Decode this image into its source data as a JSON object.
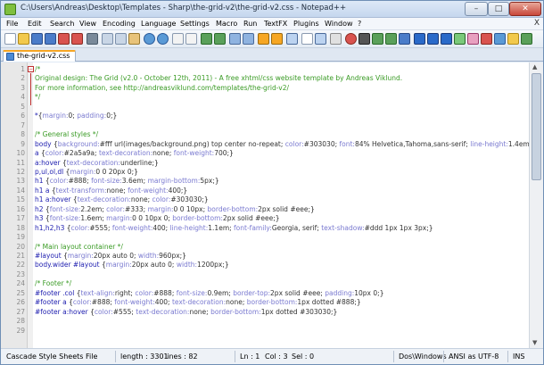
{
  "window": {
    "title": "C:\\Users\\Andreas\\Desktop\\Templates - Sharp\\the-grid-v2\\the-grid-v2.css - Notepad++",
    "min_label": "–",
    "max_label": "□",
    "close_label": "✕"
  },
  "menu": {
    "items": [
      "File",
      "Edit",
      "Search",
      "View",
      "Encoding",
      "Language",
      "Settings",
      "Macro",
      "Run",
      "TextFX",
      "Plugins",
      "Window",
      "?"
    ],
    "close_x": "X"
  },
  "tab": {
    "label": "the-grid-v2.css"
  },
  "lines": [
    {
      "n": "1",
      "parts": [
        [
          "c-comment",
          "/*"
        ]
      ]
    },
    {
      "n": "2",
      "parts": [
        [
          "c-comment",
          "Original design: The Grid (v2.0 - October 12th, 2011) - A free xhtml/css website template by Andreas Viklund."
        ]
      ]
    },
    {
      "n": "3",
      "parts": [
        [
          "c-comment",
          "For more information, see http://andreasviklund.com/templates/the-grid-v2/"
        ]
      ]
    },
    {
      "n": "4",
      "parts": [
        [
          "c-comment",
          "*/"
        ]
      ]
    },
    {
      "n": "5",
      "parts": []
    },
    {
      "n": "6",
      "parts": [
        [
          "c-sel",
          "*"
        ],
        [
          "c-br",
          "{"
        ],
        [
          "c-prop",
          "margin:"
        ],
        [
          "c-val",
          "0; "
        ],
        [
          "c-prop",
          "padding:"
        ],
        [
          "c-val",
          "0;"
        ],
        [
          "c-br",
          "}"
        ]
      ]
    },
    {
      "n": "7",
      "parts": []
    },
    {
      "n": "8",
      "parts": [
        [
          "c-comment",
          "/* General styles */"
        ]
      ]
    },
    {
      "n": "9",
      "parts": [
        [
          "c-sel",
          "body "
        ],
        [
          "c-br",
          "{"
        ],
        [
          "c-prop",
          "background:"
        ],
        [
          "c-val",
          "#fff url(images/background.png) top center no-repeat; "
        ],
        [
          "c-prop",
          "color:"
        ],
        [
          "c-val",
          "#303030; "
        ],
        [
          "c-prop",
          "font:"
        ],
        [
          "c-val",
          "84% Helvetica,Tahoma,sans-serif; "
        ],
        [
          "c-prop",
          "line-height:"
        ],
        [
          "c-val",
          "1.4em;"
        ],
        [
          "c-br",
          "}"
        ]
      ]
    },
    {
      "n": "10",
      "parts": [
        [
          "c-sel",
          "a "
        ],
        [
          "c-br",
          "{"
        ],
        [
          "c-prop",
          "color:"
        ],
        [
          "c-val",
          "#2a5a9a; "
        ],
        [
          "c-prop",
          "text-decoration:"
        ],
        [
          "c-val",
          "none; "
        ],
        [
          "c-prop",
          "font-weight:"
        ],
        [
          "c-val",
          "700;"
        ],
        [
          "c-br",
          "}"
        ]
      ]
    },
    {
      "n": "11",
      "parts": [
        [
          "c-sel",
          "a:hover "
        ],
        [
          "c-br",
          "{"
        ],
        [
          "c-prop",
          "text-decoration:"
        ],
        [
          "c-val",
          "underline;"
        ],
        [
          "c-br",
          "}"
        ]
      ]
    },
    {
      "n": "12",
      "parts": [
        [
          "c-sel",
          "p,ul,ol,dl "
        ],
        [
          "c-br",
          "{"
        ],
        [
          "c-prop",
          "margin:"
        ],
        [
          "c-val",
          "0 0 20px 0;"
        ],
        [
          "c-br",
          "}"
        ]
      ]
    },
    {
      "n": "13",
      "parts": [
        [
          "c-sel",
          "h1 "
        ],
        [
          "c-br",
          "{"
        ],
        [
          "c-prop",
          "color:"
        ],
        [
          "c-val",
          "#888; "
        ],
        [
          "c-prop",
          "font-size:"
        ],
        [
          "c-val",
          "3.6em; "
        ],
        [
          "c-prop",
          "margin-bottom:"
        ],
        [
          "c-val",
          "5px;"
        ],
        [
          "c-br",
          "}"
        ]
      ]
    },
    {
      "n": "14",
      "parts": [
        [
          "c-sel",
          "h1 a "
        ],
        [
          "c-br",
          "{"
        ],
        [
          "c-prop",
          "text-transform:"
        ],
        [
          "c-val",
          "none; "
        ],
        [
          "c-prop",
          "font-weight:"
        ],
        [
          "c-val",
          "400;"
        ],
        [
          "c-br",
          "}"
        ]
      ]
    },
    {
      "n": "15",
      "parts": [
        [
          "c-sel",
          "h1 a:hover "
        ],
        [
          "c-br",
          "{"
        ],
        [
          "c-prop",
          "text-decoration:"
        ],
        [
          "c-val",
          "none; "
        ],
        [
          "c-prop",
          "color:"
        ],
        [
          "c-val",
          "#303030;"
        ],
        [
          "c-br",
          "}"
        ]
      ]
    },
    {
      "n": "16",
      "parts": [
        [
          "c-sel",
          "h2 "
        ],
        [
          "c-br",
          "{"
        ],
        [
          "c-prop",
          "font-size:"
        ],
        [
          "c-val",
          "2.2em; "
        ],
        [
          "c-prop",
          "color:"
        ],
        [
          "c-val",
          "#333; "
        ],
        [
          "c-prop",
          "margin:"
        ],
        [
          "c-val",
          "0 0 10px; "
        ],
        [
          "c-prop",
          "border-bottom:"
        ],
        [
          "c-val",
          "2px solid #eee;"
        ],
        [
          "c-br",
          "}"
        ]
      ]
    },
    {
      "n": "17",
      "parts": [
        [
          "c-sel",
          "h3 "
        ],
        [
          "c-br",
          "{"
        ],
        [
          "c-prop",
          "font-size:"
        ],
        [
          "c-val",
          "1.6em; "
        ],
        [
          "c-prop",
          "margin:"
        ],
        [
          "c-val",
          "0 0 10px 0; "
        ],
        [
          "c-prop",
          "border-bottom:"
        ],
        [
          "c-val",
          "2px solid #eee;"
        ],
        [
          "c-br",
          "}"
        ]
      ]
    },
    {
      "n": "18",
      "parts": [
        [
          "c-sel",
          "h1,h2,h3 "
        ],
        [
          "c-br",
          "{"
        ],
        [
          "c-prop",
          "color:"
        ],
        [
          "c-val",
          "#555; "
        ],
        [
          "c-prop",
          "font-weight:"
        ],
        [
          "c-val",
          "400; "
        ],
        [
          "c-prop",
          "line-height:"
        ],
        [
          "c-val",
          "1.1em; "
        ],
        [
          "c-prop",
          "font-family:"
        ],
        [
          "c-val",
          "Georgia, serif; "
        ],
        [
          "c-prop",
          "text-shadow:"
        ],
        [
          "c-val",
          "#ddd 1px 1px 3px;"
        ],
        [
          "c-br",
          "}"
        ]
      ]
    },
    {
      "n": "19",
      "parts": []
    },
    {
      "n": "20",
      "parts": [
        [
          "c-comment",
          "/* Main layout container */"
        ]
      ]
    },
    {
      "n": "21",
      "parts": [
        [
          "c-sel",
          "#layout "
        ],
        [
          "c-br",
          "{"
        ],
        [
          "c-prop",
          "margin:"
        ],
        [
          "c-val",
          "20px auto 0; "
        ],
        [
          "c-prop",
          "width:"
        ],
        [
          "c-val",
          "960px;"
        ],
        [
          "c-br",
          "}"
        ]
      ]
    },
    {
      "n": "22",
      "parts": [
        [
          "c-sel",
          "body.wider #layout "
        ],
        [
          "c-br",
          "{"
        ],
        [
          "c-prop",
          "margin:"
        ],
        [
          "c-val",
          "20px auto 0; "
        ],
        [
          "c-prop",
          "width:"
        ],
        [
          "c-val",
          "1200px;"
        ],
        [
          "c-br",
          "}"
        ]
      ]
    },
    {
      "n": "23",
      "parts": []
    },
    {
      "n": "24",
      "parts": [
        [
          "c-comment",
          "/* Footer */"
        ]
      ]
    },
    {
      "n": "25",
      "parts": [
        [
          "c-sel",
          "#footer .col "
        ],
        [
          "c-br",
          "{"
        ],
        [
          "c-prop",
          "text-align:"
        ],
        [
          "c-val",
          "right; "
        ],
        [
          "c-prop",
          "color:"
        ],
        [
          "c-val",
          "#888; "
        ],
        [
          "c-prop",
          "font-size:"
        ],
        [
          "c-val",
          "0.9em; "
        ],
        [
          "c-prop",
          "border-top:"
        ],
        [
          "c-val",
          "2px solid #eee; "
        ],
        [
          "c-prop",
          "padding:"
        ],
        [
          "c-val",
          "10px 0;"
        ],
        [
          "c-br",
          "}"
        ]
      ]
    },
    {
      "n": "26",
      "parts": [
        [
          "c-sel",
          "#footer a "
        ],
        [
          "c-br",
          "{"
        ],
        [
          "c-prop",
          "color:"
        ],
        [
          "c-val",
          "#888; "
        ],
        [
          "c-prop",
          "font-weight:"
        ],
        [
          "c-val",
          "400; "
        ],
        [
          "c-prop",
          "text-decoration:"
        ],
        [
          "c-val",
          "none; "
        ],
        [
          "c-prop",
          "border-bottom:"
        ],
        [
          "c-val",
          "1px dotted #888;"
        ],
        [
          "c-br",
          "}"
        ]
      ]
    },
    {
      "n": "27",
      "parts": [
        [
          "c-sel",
          "#footer a:hover "
        ],
        [
          "c-br",
          "{"
        ],
        [
          "c-prop",
          "color:"
        ],
        [
          "c-val",
          "#555; "
        ],
        [
          "c-prop",
          "text-decoration:"
        ],
        [
          "c-val",
          "none; "
        ],
        [
          "c-prop",
          "border-bottom:"
        ],
        [
          "c-val",
          "1px dotted #303030;"
        ],
        [
          "c-br",
          "}"
        ]
      ]
    },
    {
      "n": "28",
      "parts": []
    },
    {
      "n": "29",
      "parts": []
    }
  ],
  "status": {
    "file_type": "Cascade Style Sheets File",
    "length": "length : 3301",
    "lines": "lines : 82",
    "ln": "Ln : 1",
    "col": "Col : 3",
    "sel": "Sel : 0",
    "eol": "Dos\\Windows",
    "encoding": "ANSI as UTF-8",
    "mode": "INS"
  },
  "colors": {
    "comment": "#3a9b25",
    "selector": "#1d1daf",
    "property": "#7a7ad0",
    "value": "#333333",
    "tab_accent": "#f6a623"
  }
}
